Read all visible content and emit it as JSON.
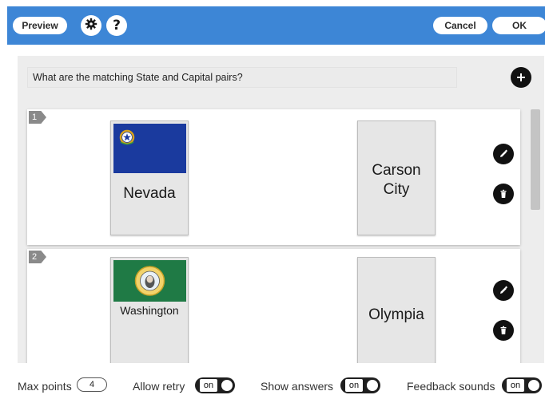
{
  "header": {
    "preview_label": "Preview",
    "settings_icon": "gear-icon",
    "help_icon": "question-icon",
    "help_glyph": "?",
    "cancel_label": "Cancel",
    "ok_label": "OK",
    "background_color": "#3d86d6"
  },
  "question": {
    "text": "What are the matching State and Capital pairs?",
    "add_icon": "plus-icon"
  },
  "pairs": [
    {
      "number": "1",
      "left": {
        "label": "Nevada",
        "flag_icon": "nevada-flag-icon",
        "flag_color": "#1a3a9e"
      },
      "right": {
        "label": "Carson City"
      },
      "edit_icon": "pencil-icon",
      "delete_icon": "trash-icon"
    },
    {
      "number": "2",
      "left": {
        "label": "Washington",
        "flag_icon": "washington-flag-icon",
        "flag_color": "#1f7a45"
      },
      "right": {
        "label": "Olympia"
      },
      "edit_icon": "pencil-icon",
      "delete_icon": "trash-icon"
    }
  ],
  "footer": {
    "max_points_label": "Max points",
    "max_points_value": "4",
    "allow_retry_label": "Allow retry",
    "allow_retry_state": "on",
    "show_answers_label": "Show answers",
    "show_answers_state": "on",
    "feedback_sounds_label": "Feedback sounds",
    "feedback_sounds_state": "on"
  }
}
